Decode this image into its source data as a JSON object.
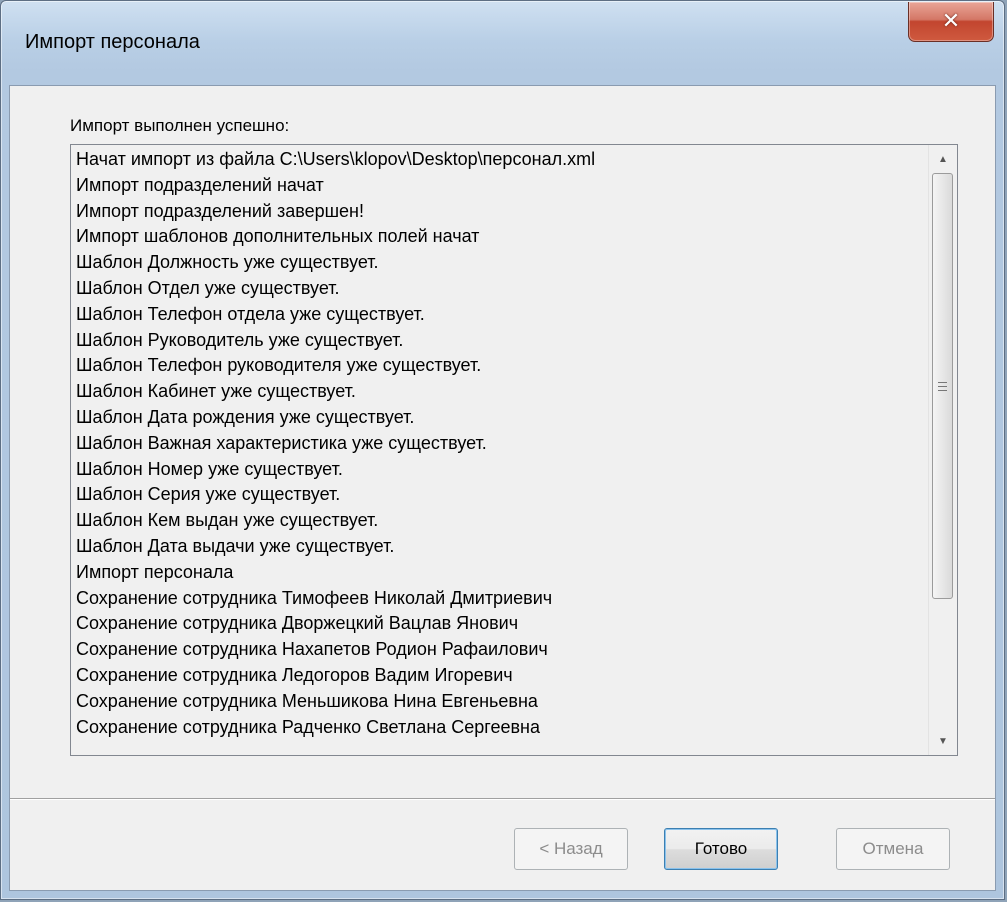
{
  "window": {
    "title": "Импорт персонала",
    "close_glyph": "✕"
  },
  "content": {
    "heading": "Импорт выполнен успешно:",
    "log_lines": [
      "Начат импорт из файла C:\\Users\\klopov\\Desktop\\персонал.xml",
      "Импорт подразделений начат",
      "Импорт подразделений завершен!",
      "Импорт шаблонов дополнительных полей начат",
      "Шаблон Должность уже существует.",
      "Шаблон Отдел уже существует.",
      "Шаблон Телефон отдела уже существует.",
      "Шаблон Руководитель уже существует.",
      "Шаблон Телефон руководителя уже существует.",
      "Шаблон Кабинет уже существует.",
      "Шаблон Дата рождения уже существует.",
      "Шаблон Важная характеристика уже существует.",
      "Шаблон Номер уже существует.",
      "Шаблон Серия уже существует.",
      "Шаблон Кем выдан уже существует.",
      "Шаблон Дата выдачи уже существует.",
      "Импорт персонала",
      "Сохранение сотрудника Тимофеев Николай Дмитриевич",
      "Сохранение сотрудника Дворжецкий Вацлав Янович",
      "Сохранение сотрудника Нахапетов Родион Рафаилович",
      "Сохранение сотрудника Ледогоров Вадим Игоревич",
      "Сохранение сотрудника Меньшикова Нина Евгеньевна",
      "Сохранение сотрудника Радченко Светлана Сергеевна"
    ],
    "scroll_up_glyph": "▲",
    "scroll_down_glyph": "▼"
  },
  "buttons": {
    "back_label": "< Назад",
    "finish_label": "Готово",
    "cancel_label": "Отмена"
  },
  "state": {
    "back_enabled": false,
    "finish_enabled": true,
    "cancel_enabled": false,
    "default_button": "finish"
  }
}
